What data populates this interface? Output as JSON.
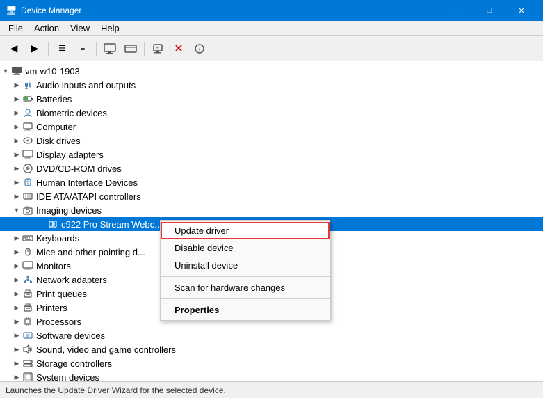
{
  "titlebar": {
    "title": "Device Manager",
    "icon": "🖥",
    "minimize": "─",
    "maximize": "□",
    "close": "✕"
  },
  "menubar": {
    "items": [
      "File",
      "Action",
      "View",
      "Help"
    ]
  },
  "toolbar": {
    "buttons": [
      "◀",
      "▶",
      "☰",
      "≡",
      "🖥",
      "🖥",
      "🖊",
      "✕",
      "🔽"
    ]
  },
  "tree": {
    "root": "vm-w10-1903",
    "items": [
      {
        "label": "Audio inputs and outputs",
        "icon": "🔊",
        "indent": 1,
        "expanded": false
      },
      {
        "label": "Batteries",
        "icon": "🔋",
        "indent": 1,
        "expanded": false
      },
      {
        "label": "Biometric devices",
        "icon": "👁",
        "indent": 1,
        "expanded": false
      },
      {
        "label": "Computer",
        "icon": "🖥",
        "indent": 1,
        "expanded": false
      },
      {
        "label": "Disk drives",
        "icon": "💾",
        "indent": 1,
        "expanded": false
      },
      {
        "label": "Display adapters",
        "icon": "🖥",
        "indent": 1,
        "expanded": false
      },
      {
        "label": "DVD/CD-ROM drives",
        "icon": "💿",
        "indent": 1,
        "expanded": false
      },
      {
        "label": "Human Interface Devices",
        "icon": "🖱",
        "indent": 1,
        "expanded": false
      },
      {
        "label": "IDE ATA/ATAPI controllers",
        "icon": "💾",
        "indent": 1,
        "expanded": false
      },
      {
        "label": "Imaging devices",
        "icon": "📷",
        "indent": 1,
        "expanded": true
      },
      {
        "label": "c922 Pro Stream Webc...",
        "icon": "📷",
        "indent": 2,
        "expanded": false,
        "selected": true
      },
      {
        "label": "Keyboards",
        "icon": "⌨",
        "indent": 1,
        "expanded": false
      },
      {
        "label": "Mice and other pointing d...",
        "icon": "🖱",
        "indent": 1,
        "expanded": false
      },
      {
        "label": "Monitors",
        "icon": "🖥",
        "indent": 1,
        "expanded": false
      },
      {
        "label": "Network adapters",
        "icon": "🌐",
        "indent": 1,
        "expanded": false
      },
      {
        "label": "Print queues",
        "icon": "🖨",
        "indent": 1,
        "expanded": false
      },
      {
        "label": "Printers",
        "icon": "🖨",
        "indent": 1,
        "expanded": false
      },
      {
        "label": "Processors",
        "icon": "⚙",
        "indent": 1,
        "expanded": false
      },
      {
        "label": "Software devices",
        "icon": "💾",
        "indent": 1,
        "expanded": false
      },
      {
        "label": "Sound, video and game controllers",
        "icon": "🔊",
        "indent": 1,
        "expanded": false
      },
      {
        "label": "Storage controllers",
        "icon": "💾",
        "indent": 1,
        "expanded": false
      },
      {
        "label": "System devices",
        "icon": "💻",
        "indent": 1,
        "expanded": false
      }
    ]
  },
  "context_menu": {
    "items": [
      {
        "label": "Update driver",
        "type": "active"
      },
      {
        "label": "Disable device",
        "type": "normal"
      },
      {
        "label": "Uninstall device",
        "type": "normal"
      },
      {
        "label": "sep1",
        "type": "separator"
      },
      {
        "label": "Scan for hardware changes",
        "type": "normal"
      },
      {
        "label": "sep2",
        "type": "separator"
      },
      {
        "label": "Properties",
        "type": "bold"
      }
    ]
  },
  "statusbar": {
    "text": "Launches the Update Driver Wizard for the selected device."
  }
}
